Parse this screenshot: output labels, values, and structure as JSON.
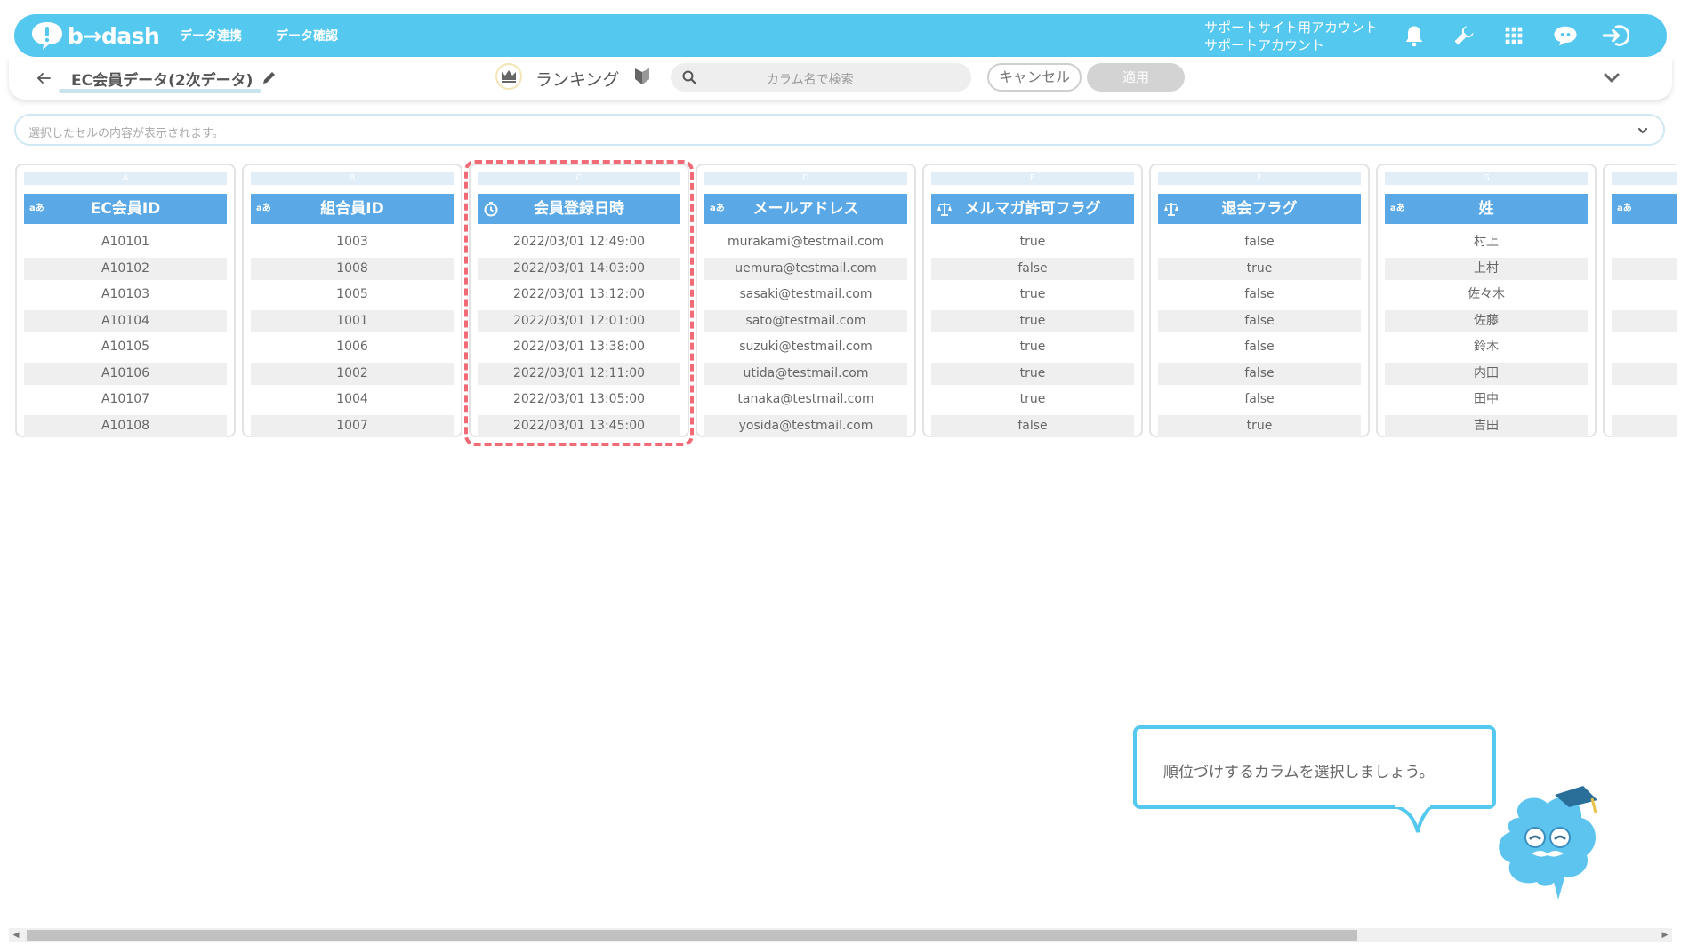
{
  "header": {
    "logo_text": "b→dash",
    "nav": [
      "データ連携",
      "データ確認"
    ],
    "account_line1": "サポートサイト用アカウント",
    "account_line2": "サポートアカウント",
    "icons": [
      "bell-icon",
      "wrench-icon",
      "grid-icon",
      "chat-icon",
      "logout-icon"
    ]
  },
  "toolbar": {
    "dataset_name": "EC会員データ(2次データ)",
    "ranking_label": "ランキング",
    "search_placeholder": "カラム名で検索",
    "cancel_label": "キャンセル",
    "apply_label": "適用"
  },
  "cell_content_placeholder": "選択したセルの内容が表示されます。",
  "columns": [
    {
      "letter": "A",
      "name": "EC会員ID",
      "type_icon": "text-type-icon",
      "values": [
        "A10101",
        "A10102",
        "A10103",
        "A10104",
        "A10105",
        "A10106",
        "A10107",
        "A10108"
      ]
    },
    {
      "letter": "B",
      "name": "組合員ID",
      "type_icon": "text-type-icon",
      "values": [
        "1003",
        "1008",
        "1005",
        "1001",
        "1006",
        "1002",
        "1004",
        "1007"
      ]
    },
    {
      "letter": "C",
      "name": "会員登録日時",
      "type_icon": "datetime-type-icon",
      "values": [
        "2022/03/01 12:49:00",
        "2022/03/01 14:03:00",
        "2022/03/01 13:12:00",
        "2022/03/01 12:01:00",
        "2022/03/01 13:38:00",
        "2022/03/01 12:11:00",
        "2022/03/01 13:05:00",
        "2022/03/01 13:45:00"
      ]
    },
    {
      "letter": "D",
      "name": "メールアドレス",
      "type_icon": "text-type-icon",
      "values": [
        "murakami@testmail.com",
        "uemura@testmail.com",
        "sasaki@testmail.com",
        "sato@testmail.com",
        "suzuki@testmail.com",
        "utida@testmail.com",
        "tanaka@testmail.com",
        "yosida@testmail.com"
      ]
    },
    {
      "letter": "E",
      "name": "メルマガ許可フラグ",
      "type_icon": "boolean-type-icon",
      "values": [
        "true",
        "false",
        "true",
        "true",
        "true",
        "true",
        "true",
        "false"
      ]
    },
    {
      "letter": "F",
      "name": "退会フラグ",
      "type_icon": "boolean-type-icon",
      "values": [
        "false",
        "true",
        "false",
        "false",
        "false",
        "false",
        "false",
        "true"
      ]
    },
    {
      "letter": "G",
      "name": "姓",
      "type_icon": "text-type-icon",
      "values": [
        "村上",
        "上村",
        "佐々木",
        "佐藤",
        "鈴木",
        "内田",
        "田中",
        "吉田"
      ]
    }
  ],
  "type_badge_text": "aあ",
  "tooltip": "順位づけするカラムを選択しましょう。",
  "colors": {
    "brand": "#54c8ef",
    "header_blue": "#5aa9e6",
    "highlight": "#f06b76"
  }
}
